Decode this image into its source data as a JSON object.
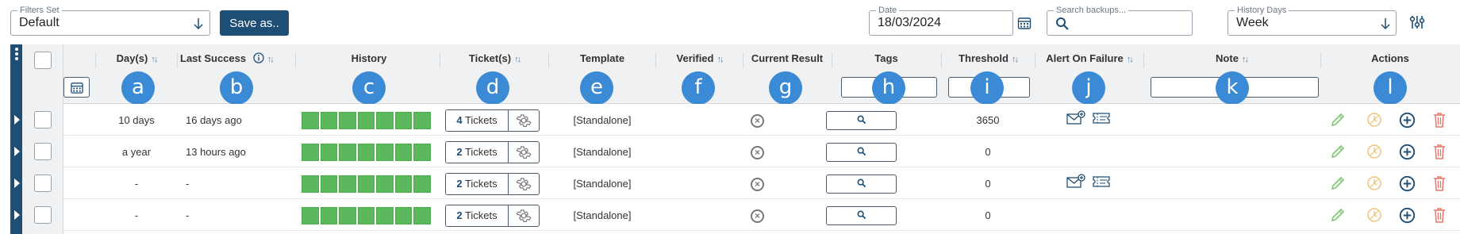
{
  "filters": {
    "filters_set_label": "Filters Set",
    "filters_set_value": "Default",
    "save_as_label": "Save as..",
    "date_label": "Date",
    "date_value": "18/03/2024",
    "search_label": "Search backups...",
    "history_days_label": "History Days",
    "history_days_value": "Week"
  },
  "columns": [
    {
      "label": "Day(s)",
      "sortable": true,
      "badge": "a"
    },
    {
      "label": "Last Success",
      "sortable": true,
      "info": true,
      "badge": "b"
    },
    {
      "label": "History",
      "sortable": false,
      "badge": "c"
    },
    {
      "label": "Ticket(s)",
      "sortable": true,
      "badge": "d"
    },
    {
      "label": "Template",
      "sortable": false,
      "badge": "e"
    },
    {
      "label": "Verified",
      "sortable": true,
      "badge": "f"
    },
    {
      "label": "Current Result",
      "sortable": false,
      "badge": "g"
    },
    {
      "label": "Tags",
      "sortable": false,
      "badge": "h"
    },
    {
      "label": "Threshold",
      "sortable": true,
      "badge": "i"
    },
    {
      "label": "Alert On Failure",
      "sortable": true,
      "badge": "j"
    },
    {
      "label": "Note",
      "sortable": true,
      "badge": "k"
    },
    {
      "label": "Actions",
      "sortable": false,
      "badge": "l"
    }
  ],
  "rows": [
    {
      "days": "10 days",
      "last_success": "16 days ago",
      "tickets_count": "4",
      "tickets_word": "Tickets",
      "template": "[Standalone]",
      "threshold": "3650",
      "alert_icons": true
    },
    {
      "days": "a year",
      "last_success": "13 hours ago",
      "tickets_count": "2",
      "tickets_word": "Tickets",
      "template": "[Standalone]",
      "threshold": "0",
      "alert_icons": false
    },
    {
      "days": "-",
      "last_success": "-",
      "tickets_count": "2",
      "tickets_word": "Tickets",
      "template": "[Standalone]",
      "threshold": "0",
      "alert_icons": true
    },
    {
      "days": "-",
      "last_success": "-",
      "tickets_count": "2",
      "tickets_word": "Tickets",
      "template": "[Standalone]",
      "threshold": "0",
      "alert_icons": false
    }
  ],
  "colors": {
    "primary": "#1f4e75",
    "badge": "#3a8ad6",
    "history_ok": "#5cb85c",
    "edit": "#7bc96f",
    "pause": "#f0c27b",
    "add": "#1f4e75",
    "delete": "#e8736b"
  },
  "icons": {
    "date_picker": "calendar-icon",
    "search": "search-icon",
    "history_days": "chevron-down-icon",
    "settings": "sliders-icon"
  }
}
